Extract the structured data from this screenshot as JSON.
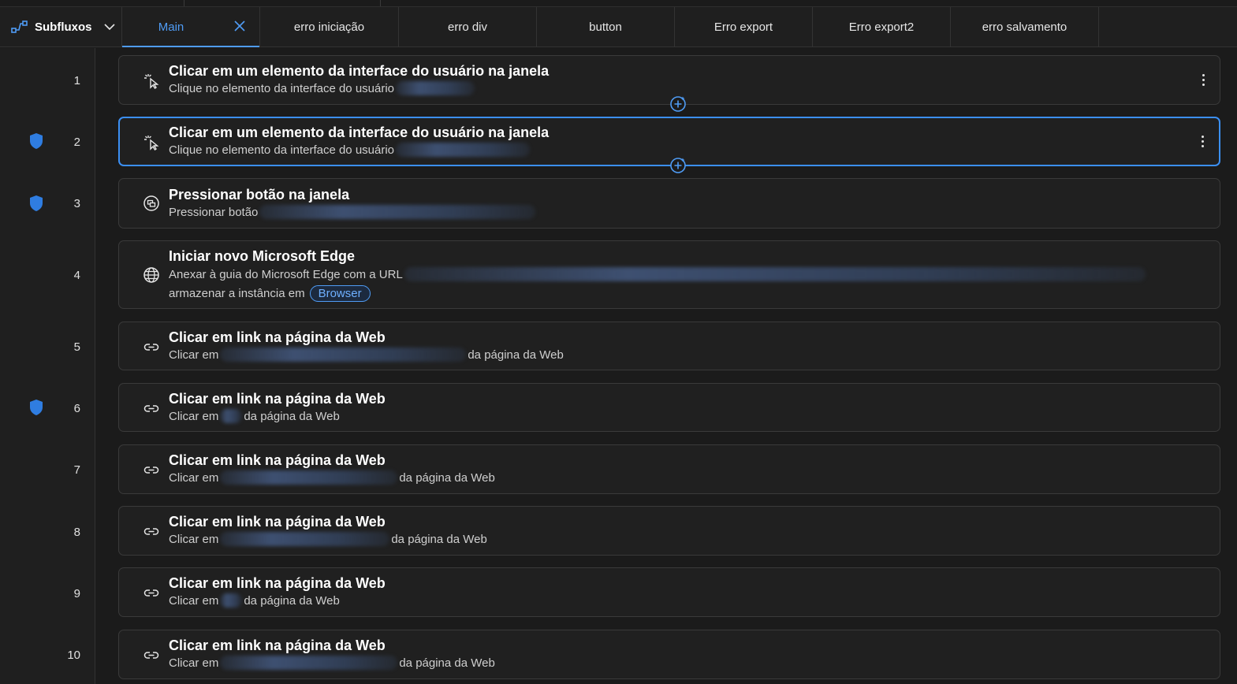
{
  "header": {
    "subflows_label": "Subfluxos",
    "tabs": [
      {
        "label": "Main"
      },
      {
        "label": "erro iniciação"
      },
      {
        "label": "erro div"
      },
      {
        "label": "button"
      },
      {
        "label": "Erro export"
      },
      {
        "label": "Erro export2"
      },
      {
        "label": "erro salvamento"
      }
    ]
  },
  "colors": {
    "accent": "#4f9cf5",
    "selected_border": "#3b8ff3",
    "shield": "#2f7de1",
    "background": "#1b1b1b",
    "card": "#202020"
  },
  "actions": [
    {
      "line": "1",
      "title": "Clicar em um elemento da interface do usuário na janela",
      "sub_prefix": "Clique no elemento da interface do usuário",
      "sub_suffix": "",
      "icon": "cursor-click-icon",
      "shield": false,
      "selected": false
    },
    {
      "line": "2",
      "title": "Clicar em um elemento da interface do usuário na janela",
      "sub_prefix": "Clique no elemento da interface do usuário",
      "sub_suffix": "",
      "icon": "cursor-click-icon",
      "shield": true,
      "selected": true
    },
    {
      "line": "3",
      "title": "Pressionar botão na janela",
      "sub_prefix": "Pressionar botão",
      "sub_suffix": "",
      "icon": "press-button-icon",
      "shield": true,
      "selected": false
    },
    {
      "line": "4",
      "title": "Iniciar novo Microsoft Edge",
      "sub_prefix": "Anexar à guia do Microsoft Edge com a URL",
      "sub_line2": "armazenar a instância em",
      "variable": "Browser",
      "icon": "globe-icon",
      "shield": false,
      "selected": false
    },
    {
      "line": "5",
      "title": "Clicar em link na página da Web",
      "sub_prefix": "Clicar em",
      "sub_suffix": "da página da Web",
      "icon": "link-icon",
      "shield": false,
      "selected": false
    },
    {
      "line": "6",
      "title": "Clicar em link na página da Web",
      "sub_prefix": "Clicar em",
      "sub_suffix": "da página da Web",
      "icon": "link-icon",
      "shield": true,
      "selected": false
    },
    {
      "line": "7",
      "title": "Clicar em link na página da Web",
      "sub_prefix": "Clicar em",
      "sub_suffix": "da página da Web",
      "icon": "link-icon",
      "shield": false,
      "selected": false
    },
    {
      "line": "8",
      "title": "Clicar em link na página da Web",
      "sub_prefix": "Clicar em",
      "sub_suffix": "da página da Web",
      "icon": "link-icon",
      "shield": false,
      "selected": false
    },
    {
      "line": "9",
      "title": "Clicar em link na página da Web",
      "sub_prefix": "Clicar em",
      "sub_suffix": "da página da Web",
      "icon": "link-icon",
      "shield": false,
      "selected": false
    },
    {
      "line": "10",
      "title": "Clicar em link na página da Web",
      "sub_prefix": "Clicar em",
      "sub_suffix": "da página da Web",
      "icon": "link-icon",
      "shield": false,
      "selected": false
    }
  ]
}
